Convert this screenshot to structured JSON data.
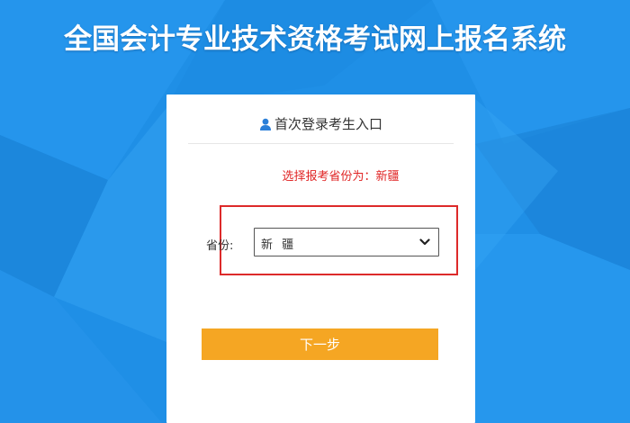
{
  "header": {
    "title": "全国会计专业技术资格考试网上报名系统"
  },
  "login_card": {
    "heading": "首次登录考生入口",
    "heading_icon": "user-icon",
    "selected_province_note": "选择报考省份为：新疆",
    "province_label": "省份:",
    "province_select": {
      "value": "新 疆",
      "icon": "chevron-down-icon"
    },
    "next_label": "下一步"
  },
  "colors": {
    "background": "#1f8fe6",
    "note_text": "#e02424",
    "highlight_border": "#dd2a2a",
    "button": "#f5a623",
    "user_icon": "#2b7fd8"
  }
}
